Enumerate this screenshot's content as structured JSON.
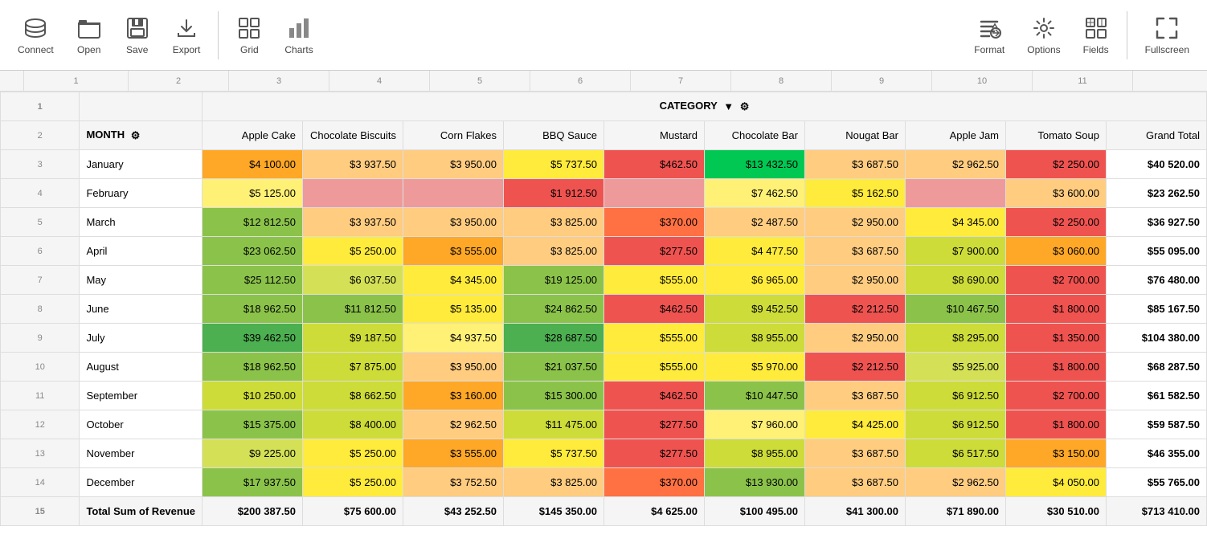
{
  "toolbar": {
    "connect_label": "Connect",
    "open_label": "Open",
    "save_label": "Save",
    "export_label": "Export",
    "grid_label": "Grid",
    "charts_label": "Charts",
    "format_label": "Format",
    "options_label": "Options",
    "fields_label": "Fields",
    "fullscreen_label": "Fullscreen"
  },
  "colNumbers": [
    "",
    "1",
    "2",
    "3",
    "4",
    "5",
    "6",
    "7",
    "8",
    "9",
    "10",
    "11"
  ],
  "categoryLabel": "CATEGORY",
  "headers": {
    "month": "MONTH",
    "cols": [
      "Apple Cake",
      "Chocolate Biscuits",
      "Corn Flakes",
      "BBQ Sauce",
      "Mustard",
      "Chocolate Bar",
      "Nougat Bar",
      "Apple Jam",
      "Tomato Soup",
      "Grand Total"
    ]
  },
  "rows": [
    {
      "num": "3",
      "month": "January",
      "vals": [
        "$4 100.00",
        "$3 937.50",
        "$3 950.00",
        "$5 737.50",
        "$462.50",
        "$13 432.50",
        "$3 687.50",
        "$2 962.50",
        "$2 250.00",
        "$40 520.00"
      ],
      "classes": [
        "c-orange",
        "c-orange-light",
        "c-orange-light",
        "c-yellow",
        "c-red",
        "c-bright-green",
        "c-orange-light",
        "c-orange-light",
        "c-red",
        ""
      ]
    },
    {
      "num": "4",
      "month": "February",
      "vals": [
        "$5 125.00",
        "",
        "",
        "$1 912.50",
        "",
        "$7 462.50",
        "$5 162.50",
        "",
        "$3 600.00",
        "$23 262.50"
      ],
      "classes": [
        "c-yellow-light",
        "c-empty",
        "c-empty",
        "c-red",
        "c-empty",
        "c-yellow-light",
        "c-yellow",
        "c-empty",
        "c-orange-light",
        ""
      ]
    },
    {
      "num": "5",
      "month": "March",
      "vals": [
        "$12 812.50",
        "$3 937.50",
        "$3 950.00",
        "$3 825.00",
        "$370.00",
        "$2 487.50",
        "$2 950.00",
        "$4 345.00",
        "$2 250.00",
        "$36 927.50"
      ],
      "classes": [
        "c-green",
        "c-orange-light",
        "c-orange-light",
        "c-orange-light",
        "c-orange-dark",
        "c-orange-light",
        "c-orange-light",
        "c-yellow",
        "c-red",
        ""
      ]
    },
    {
      "num": "6",
      "month": "April",
      "vals": [
        "$23 062.50",
        "$5 250.00",
        "$3 555.00",
        "$3 825.00",
        "$277.50",
        "$4 477.50",
        "$3 687.50",
        "$7 900.00",
        "$3 060.00",
        "$55 095.00"
      ],
      "classes": [
        "c-green",
        "c-yellow",
        "c-orange",
        "c-orange-light",
        "c-red",
        "c-yellow",
        "c-orange-light",
        "c-green-light",
        "c-orange",
        ""
      ]
    },
    {
      "num": "7",
      "month": "May",
      "vals": [
        "$25 112.50",
        "$6 037.50",
        "$4 345.00",
        "$19 125.00",
        "$555.00",
        "$6 965.00",
        "$2 950.00",
        "$8 690.00",
        "$2 700.00",
        "$76 480.00"
      ],
      "classes": [
        "c-green",
        "c-yellow-green",
        "c-yellow",
        "c-green",
        "c-yellow",
        "c-yellow",
        "c-orange-light",
        "c-green-light",
        "c-red",
        ""
      ]
    },
    {
      "num": "8",
      "month": "June",
      "vals": [
        "$18 962.50",
        "$11 812.50",
        "$5 135.00",
        "$24 862.50",
        "$462.50",
        "$9 452.50",
        "$2 212.50",
        "$10 467.50",
        "$1 800.00",
        "$85 167.50"
      ],
      "classes": [
        "c-green",
        "c-green",
        "c-yellow",
        "c-green",
        "c-red",
        "c-green-light",
        "c-red",
        "c-green",
        "c-red",
        ""
      ]
    },
    {
      "num": "9",
      "month": "July",
      "vals": [
        "$39 462.50",
        "$9 187.50",
        "$4 937.50",
        "$28 687.50",
        "$555.00",
        "$8 955.00",
        "$2 950.00",
        "$8 295.00",
        "$1 350.00",
        "$104 380.00"
      ],
      "classes": [
        "c-green-dark",
        "c-green-light",
        "c-yellow-light",
        "c-green-dark",
        "c-yellow",
        "c-green-light",
        "c-orange-light",
        "c-green-light",
        "c-red",
        ""
      ]
    },
    {
      "num": "10",
      "month": "August",
      "vals": [
        "$18 962.50",
        "$7 875.00",
        "$3 950.00",
        "$21 037.50",
        "$555.00",
        "$5 970.00",
        "$2 212.50",
        "$5 925.00",
        "$1 800.00",
        "$68 287.50"
      ],
      "classes": [
        "c-green",
        "c-green-light",
        "c-orange-light",
        "c-green",
        "c-yellow",
        "c-yellow",
        "c-red",
        "c-yellow-green",
        "c-red",
        ""
      ]
    },
    {
      "num": "11",
      "month": "September",
      "vals": [
        "$10 250.00",
        "$8 662.50",
        "$3 160.00",
        "$15 300.00",
        "$462.50",
        "$10 447.50",
        "$3 687.50",
        "$6 912.50",
        "$2 700.00",
        "$61 582.50"
      ],
      "classes": [
        "c-green-light",
        "c-green-light",
        "c-orange",
        "c-green",
        "c-red",
        "c-green",
        "c-orange-light",
        "c-green-light",
        "c-red",
        ""
      ]
    },
    {
      "num": "12",
      "month": "October",
      "vals": [
        "$15 375.00",
        "$8 400.00",
        "$2 962.50",
        "$11 475.00",
        "$277.50",
        "$7 960.00",
        "$4 425.00",
        "$6 912.50",
        "$1 800.00",
        "$59 587.50"
      ],
      "classes": [
        "c-green",
        "c-green-light",
        "c-orange-light",
        "c-green-light",
        "c-red",
        "c-yellow-light",
        "c-yellow",
        "c-green-light",
        "c-red",
        ""
      ]
    },
    {
      "num": "13",
      "month": "November",
      "vals": [
        "$9 225.00",
        "$5 250.00",
        "$3 555.00",
        "$5 737.50",
        "$277.50",
        "$8 955.00",
        "$3 687.50",
        "$6 517.50",
        "$3 150.00",
        "$46 355.00"
      ],
      "classes": [
        "c-yellow-green",
        "c-yellow",
        "c-orange",
        "c-yellow",
        "c-red",
        "c-green-light",
        "c-orange-light",
        "c-green-light",
        "c-orange",
        ""
      ]
    },
    {
      "num": "14",
      "month": "December",
      "vals": [
        "$17 937.50",
        "$5 250.00",
        "$3 752.50",
        "$3 825.00",
        "$370.00",
        "$13 930.00",
        "$3 687.50",
        "$2 962.50",
        "$4 050.00",
        "$55 765.00"
      ],
      "classes": [
        "c-green",
        "c-yellow",
        "c-orange-light",
        "c-orange-light",
        "c-orange-dark",
        "c-green",
        "c-orange-light",
        "c-orange-light",
        "c-yellow",
        ""
      ]
    }
  ],
  "totalRow": {
    "num": "15",
    "month": "Total Sum of Revenue",
    "vals": [
      "$200 387.50",
      "$75 600.00",
      "$43 252.50",
      "$145 350.00",
      "$4 625.00",
      "$100 495.00",
      "$41 300.00",
      "$71 890.00",
      "$30 510.00",
      "$713 410.00"
    ]
  }
}
